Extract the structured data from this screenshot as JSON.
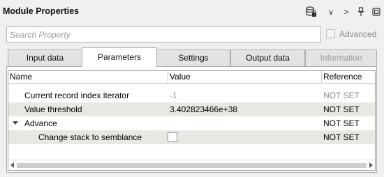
{
  "header": {
    "title": "Module Properties",
    "icons": [
      "database-lock-icon",
      "chevron-down-icon",
      "chevron-right-icon",
      "pin-icon",
      "restore-icon"
    ],
    "icon_glyphs": {
      "chevron_down": "∨",
      "chevron_right": ">"
    }
  },
  "search": {
    "placeholder": "Search Property",
    "value": ""
  },
  "advanced": {
    "label": "Advanced",
    "checked": false
  },
  "tabs": [
    {
      "label": "Input data"
    },
    {
      "label": "Parameters",
      "active": true
    },
    {
      "label": "Settings"
    },
    {
      "label": "Output data"
    },
    {
      "label": "Information",
      "disabled": true
    }
  ],
  "table": {
    "columns": [
      "Name",
      "Value",
      "Reference"
    ],
    "rows": [
      {
        "name": "Current record index iterator",
        "value": "-1",
        "reference": "NOT SET"
      },
      {
        "name": "Value threshold",
        "value": "3.402823466e+38",
        "reference": "NOT SET"
      },
      {
        "name": "Advance",
        "value": "",
        "reference": "NOT SET",
        "group": true,
        "expanded": true
      },
      {
        "name": "Change stack to semblance",
        "value": "",
        "reference": "NOT SET",
        "checkbox": false
      }
    ]
  },
  "colors": {
    "alt_row": "#e9e7e2",
    "dim_text": "#8c8c8c",
    "border": "#adadad"
  }
}
